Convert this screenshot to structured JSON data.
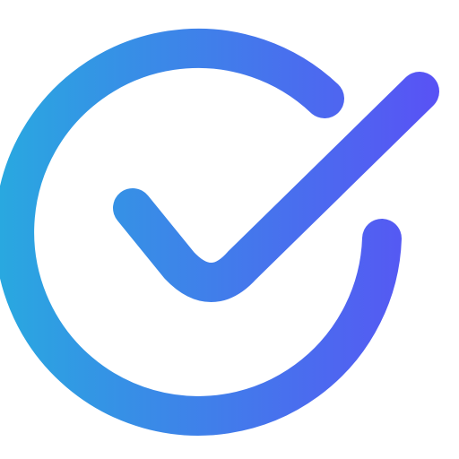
{
  "icon": {
    "name": "check-circle-icon",
    "gradient_start": "#29A8E0",
    "gradient_end": "#5B4EF6",
    "background": "#FFFFFF"
  }
}
